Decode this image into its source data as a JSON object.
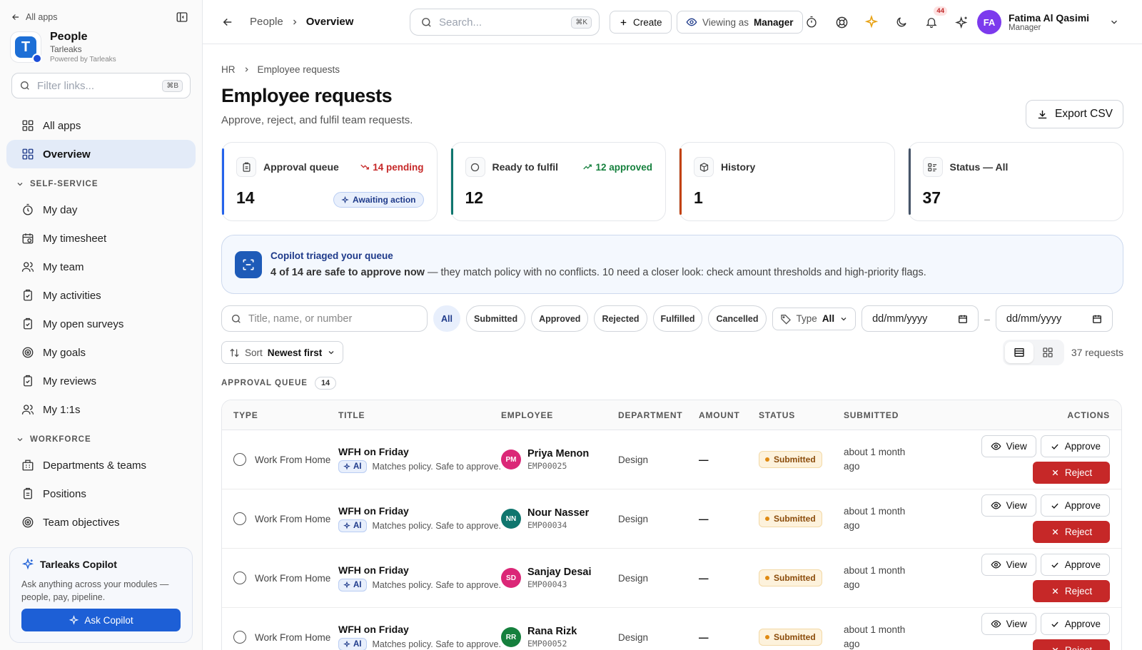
{
  "sidebar": {
    "all_apps_link": "All apps",
    "app_name": "People",
    "org_name": "Tarleaks",
    "powered_by": "Powered by Tarleaks",
    "logo_letter": "T",
    "filter_placeholder": "Filter links...",
    "filter_shortcut": "⌘B",
    "top_items": [
      {
        "label": "All apps",
        "icon": "grid-icon"
      },
      {
        "label": "Overview",
        "icon": "grid-icon",
        "active": true
      }
    ],
    "section_self_service": "SELF-SERVICE",
    "self_service_items": [
      {
        "label": "My day",
        "icon": "timer-icon"
      },
      {
        "label": "My timesheet",
        "icon": "calendar-clock-icon"
      },
      {
        "label": "My team",
        "icon": "users-icon"
      },
      {
        "label": "My activities",
        "icon": "clipboard-check-icon"
      },
      {
        "label": "My open surveys",
        "icon": "clipboard-check-icon"
      },
      {
        "label": "My goals",
        "icon": "target-icon"
      },
      {
        "label": "My reviews",
        "icon": "clipboard-check-icon"
      },
      {
        "label": "My 1:1s",
        "icon": "users-icon"
      }
    ],
    "section_workforce": "WORKFORCE",
    "workforce_items": [
      {
        "label": "Departments & teams",
        "icon": "building-icon"
      },
      {
        "label": "Positions",
        "icon": "clipboard-icon"
      },
      {
        "label": "Team objectives",
        "icon": "target-icon"
      }
    ],
    "copilot": {
      "title": "Tarleaks Copilot",
      "description": "Ask anything across your modules — people, pay, pipeline.",
      "button": "Ask Copilot"
    }
  },
  "topbar": {
    "crumb_app": "People",
    "crumb_page": "Overview",
    "search_placeholder": "Search...",
    "search_shortcut": "⌘K",
    "create_label": "Create",
    "viewing_as_label": "Viewing as",
    "viewing_as_role": "Manager",
    "notifications_count": "44",
    "user": {
      "initials": "FA",
      "name": "Fatima Al Qasimi",
      "role": "Manager"
    }
  },
  "page": {
    "breadcrumb_root": "HR",
    "breadcrumb_current": "Employee requests",
    "title": "Employee requests",
    "subtitle": "Approve, reject, and fulfil team requests.",
    "export_label": "Export CSV"
  },
  "stats": [
    {
      "label": "Approval queue",
      "value": "14",
      "trend": "14 pending",
      "trend_color": "#c62828",
      "accent": "#2563eb",
      "pill": "Awaiting action"
    },
    {
      "label": "Ready to fulfil",
      "value": "12",
      "trend": "12 approved",
      "trend_color": "#15803d",
      "accent": "#0f766e",
      "pill": ""
    },
    {
      "label": "History",
      "value": "1",
      "trend": "",
      "trend_color": "",
      "accent": "#c2410c",
      "pill": ""
    },
    {
      "label": "Status — All",
      "value": "37",
      "trend": "",
      "trend_color": "",
      "accent": "#475569",
      "pill": ""
    }
  ],
  "banner": {
    "title": "Copilot triaged your queue",
    "highlight": "4 of 14 are safe to approve now",
    "text": " — they match policy with no conflicts. 10 need a closer look: check amount thresholds and high-priority flags."
  },
  "filters": {
    "search_placeholder": "Title, name, or number",
    "chips": [
      "All",
      "Submitted",
      "Approved",
      "Rejected",
      "Fulfilled",
      "Cancelled"
    ],
    "active_chip": "All",
    "type_label": "Type",
    "type_value": "All",
    "date_from_placeholder": "dd/mm/yyyy",
    "date_to_placeholder": "dd/mm/yyyy",
    "date_separator": "–",
    "sort_label": "Sort",
    "sort_value": "Newest first",
    "count_label": "37 requests"
  },
  "queue": {
    "heading": "APPROVAL QUEUE",
    "count": "14",
    "columns": [
      "TYPE",
      "TITLE",
      "EMPLOYEE",
      "DEPARTMENT",
      "AMOUNT",
      "STATUS",
      "SUBMITTED",
      "ACTIONS"
    ],
    "ai_label": "AI",
    "view_label": "View",
    "approve_label": "Approve",
    "reject_label": "Reject",
    "rows": [
      {
        "type": "Work From Home",
        "title": "WFH on Friday",
        "note": "Matches policy. Safe to approve.",
        "initials": "PM",
        "avatar_color": "#db2777",
        "name": "Priya Menon",
        "emp_id": "EMP00025",
        "department": "Design",
        "amount": "—",
        "status": "Submitted",
        "submitted": "about 1 month ago"
      },
      {
        "type": "Work From Home",
        "title": "WFH on Friday",
        "note": "Matches policy. Safe to approve.",
        "initials": "NN",
        "avatar_color": "#0f766e",
        "name": "Nour Nasser",
        "emp_id": "EMP00034",
        "department": "Design",
        "amount": "—",
        "status": "Submitted",
        "submitted": "about 1 month ago"
      },
      {
        "type": "Work From Home",
        "title": "WFH on Friday",
        "note": "Matches policy. Safe to approve.",
        "initials": "SD",
        "avatar_color": "#db2777",
        "name": "Sanjay Desai",
        "emp_id": "EMP00043",
        "department": "Design",
        "amount": "—",
        "status": "Submitted",
        "submitted": "about 1 month ago"
      },
      {
        "type": "Work From Home",
        "title": "WFH on Friday",
        "note": "Matches policy. Safe to approve.",
        "initials": "RR",
        "avatar_color": "#15803d",
        "name": "Rana Rizk",
        "emp_id": "EMP00052",
        "department": "Design",
        "amount": "—",
        "status": "Submitted",
        "submitted": "about 1 month ago"
      }
    ]
  }
}
